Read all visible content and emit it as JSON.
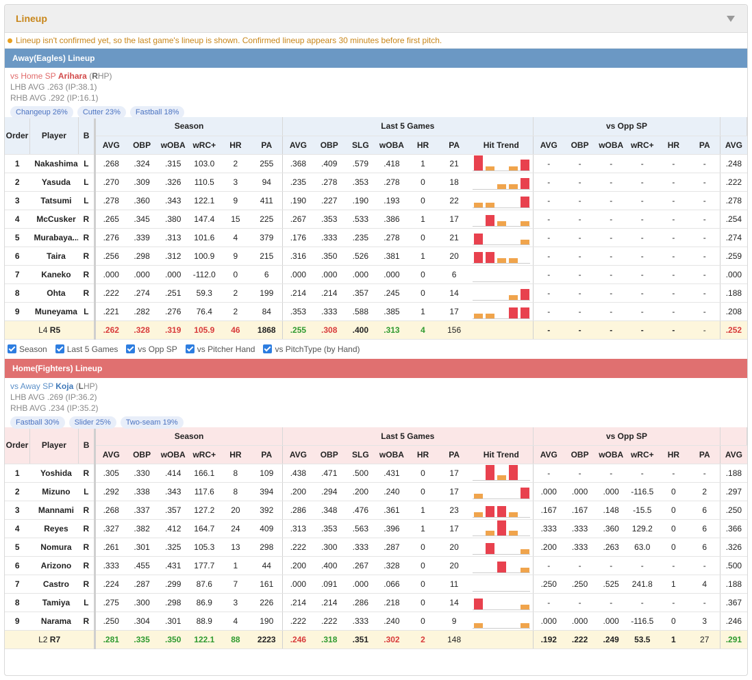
{
  "panel": {
    "title": "Lineup"
  },
  "notice": "Lineup isn't confirmed yet, so the last game's lineup is shown. Confirmed lineup appears 30 minutes before first pitch.",
  "headers": {
    "order": "Order",
    "player": "Player",
    "b": "B",
    "season": "Season",
    "last5": "Last 5 Games",
    "vsopp": "vs Opp SP",
    "avg": "AVG",
    "obp": "OBP",
    "woba": "wOBA",
    "wrc": "wRC+",
    "hr": "HR",
    "pa": "PA",
    "slg": "SLG",
    "hittrend": "Hit Trend"
  },
  "checkboxes": [
    "Season",
    "Last 5 Games",
    "vs Opp SP",
    "vs Pitcher Hand",
    "vs PitchType (by Hand)"
  ],
  "colors": {
    "hit": "#e8414e",
    "out": "#f0a44c",
    "away": "#6b98c4",
    "home": "#e07070"
  },
  "away": {
    "bar": "Away(Eagles) Lineup",
    "sp_prefix": "vs Home SP ",
    "sp_name": "Arihara",
    "sp_hand_open": "(",
    "sp_hand_letter": "R",
    "sp_hand_rest": "HP)",
    "lhb": "LHB AVG .263 (IP:38.1)",
    "rhb": "RHB AVG .292 (IP:16.1)",
    "pitches": [
      "Changeup 26%",
      "Cutter 23%",
      "Fastball 18%"
    ],
    "rows": [
      {
        "o": "1",
        "n": "Nakashima",
        "b": "L",
        "s": [
          ".268",
          ".324",
          ".315",
          "103.0",
          "2",
          "255"
        ],
        "l": [
          ".368",
          ".409",
          ".579",
          ".418",
          "1",
          "21"
        ],
        "t": [
          [
            "hit",
            22
          ],
          [
            "out",
            6
          ],
          [
            "none",
            0
          ],
          [
            "out",
            6
          ],
          [
            "hit",
            16
          ]
        ],
        "v": [
          "-",
          "-",
          "-",
          "-",
          "-",
          "-"
        ],
        "x": ".248"
      },
      {
        "o": "2",
        "n": "Yasuda",
        "b": "L",
        "s": [
          ".270",
          ".309",
          ".326",
          "110.5",
          "3",
          "94"
        ],
        "l": [
          ".235",
          ".278",
          ".353",
          ".278",
          "0",
          "18"
        ],
        "t": [
          [
            "none",
            0
          ],
          [
            "none",
            0
          ],
          [
            "out",
            7
          ],
          [
            "out",
            7
          ],
          [
            "hit",
            16
          ]
        ],
        "v": [
          "-",
          "-",
          "-",
          "-",
          "-",
          "-"
        ],
        "x": ".222"
      },
      {
        "o": "3",
        "n": "Tatsumi",
        "b": "L",
        "s": [
          ".278",
          ".360",
          ".343",
          "122.1",
          "9",
          "411"
        ],
        "l": [
          ".190",
          ".227",
          ".190",
          ".193",
          "0",
          "22"
        ],
        "t": [
          [
            "out",
            7
          ],
          [
            "out",
            7
          ],
          [
            "none",
            0
          ],
          [
            "none",
            0
          ],
          [
            "hit",
            16
          ]
        ],
        "v": [
          "-",
          "-",
          "-",
          "-",
          "-",
          "-"
        ],
        "x": ".278"
      },
      {
        "o": "4",
        "n": "McCusker",
        "b": "R",
        "s": [
          ".265",
          ".345",
          ".380",
          "147.4",
          "15",
          "225"
        ],
        "l": [
          ".267",
          ".353",
          ".533",
          ".386",
          "1",
          "17"
        ],
        "t": [
          [
            "none",
            0
          ],
          [
            "hit",
            16
          ],
          [
            "out",
            7
          ],
          [
            "none",
            0
          ],
          [
            "out",
            7
          ]
        ],
        "v": [
          "-",
          "-",
          "-",
          "-",
          "-",
          "-"
        ],
        "x": ".254"
      },
      {
        "o": "5",
        "n": "Murabaya...",
        "b": "R",
        "s": [
          ".276",
          ".339",
          ".313",
          "101.6",
          "4",
          "379"
        ],
        "l": [
          ".176",
          ".333",
          ".235",
          ".278",
          "0",
          "21"
        ],
        "t": [
          [
            "hit",
            16
          ],
          [
            "none",
            0
          ],
          [
            "none",
            0
          ],
          [
            "none",
            0
          ],
          [
            "out",
            7
          ]
        ],
        "v": [
          "-",
          "-",
          "-",
          "-",
          "-",
          "-"
        ],
        "x": ".274"
      },
      {
        "o": "6",
        "n": "Taira",
        "b": "R",
        "s": [
          ".256",
          ".298",
          ".312",
          "100.9",
          "9",
          "215"
        ],
        "l": [
          ".316",
          ".350",
          ".526",
          ".381",
          "1",
          "20"
        ],
        "t": [
          [
            "hit",
            16
          ],
          [
            "hit",
            16
          ],
          [
            "out",
            7
          ],
          [
            "out",
            7
          ],
          [
            "none",
            0
          ]
        ],
        "v": [
          "-",
          "-",
          "-",
          "-",
          "-",
          "-"
        ],
        "x": ".259"
      },
      {
        "o": "7",
        "n": "Kaneko",
        "b": "R",
        "s": [
          ".000",
          ".000",
          ".000",
          "-112.0",
          "0",
          "6"
        ],
        "l": [
          ".000",
          ".000",
          ".000",
          ".000",
          "0",
          "6"
        ],
        "t": [
          [
            "none",
            0
          ],
          [
            "none",
            0
          ],
          [
            "none",
            0
          ],
          [
            "none",
            0
          ],
          [
            "none",
            0
          ]
        ],
        "v": [
          "-",
          "-",
          "-",
          "-",
          "-",
          "-"
        ],
        "x": ".000"
      },
      {
        "o": "8",
        "n": "Ohta",
        "b": "R",
        "s": [
          ".222",
          ".274",
          ".251",
          "59.3",
          "2",
          "199"
        ],
        "l": [
          ".214",
          ".214",
          ".357",
          ".245",
          "0",
          "14"
        ],
        "t": [
          [
            "none",
            0
          ],
          [
            "none",
            0
          ],
          [
            "none",
            0
          ],
          [
            "out",
            7
          ],
          [
            "hit",
            16
          ]
        ],
        "v": [
          "-",
          "-",
          "-",
          "-",
          "-",
          "-"
        ],
        "x": ".188"
      },
      {
        "o": "9",
        "n": "Muneyama",
        "b": "L",
        "s": [
          ".221",
          ".282",
          ".276",
          "76.4",
          "2",
          "84"
        ],
        "l": [
          ".353",
          ".333",
          ".588",
          ".385",
          "1",
          "17"
        ],
        "t": [
          [
            "out",
            7
          ],
          [
            "out",
            7
          ],
          [
            "none",
            0
          ],
          [
            "hit",
            16
          ],
          [
            "hit",
            16
          ]
        ],
        "v": [
          "-",
          "-",
          "-",
          "-",
          "-",
          "-"
        ],
        "x": ".208"
      }
    ],
    "total": {
      "lead": "L4 ",
      "leadb": "R5",
      "s": [
        ".262",
        ".328",
        ".319",
        "105.9",
        "46",
        "1868"
      ],
      "l": [
        ".255",
        ".308",
        ".400",
        ".313",
        "4",
        "156"
      ],
      "v": [
        "-",
        "-",
        "-",
        "-",
        "-",
        "-"
      ],
      "x": ".252"
    }
  },
  "home": {
    "bar": "Home(Fighters) Lineup",
    "sp_prefix": "vs Away SP ",
    "sp_name": "Koja",
    "sp_hand_open": "(",
    "sp_hand_letter": "L",
    "sp_hand_rest": "HP)",
    "lhb": "LHB AVG .269 (IP:36.2)",
    "rhb": "RHB AVG .234 (IP:35.2)",
    "pitches": [
      "Fastball 30%",
      "Slider 25%",
      "Two-seam 19%"
    ],
    "rows": [
      {
        "o": "1",
        "n": "Yoshida",
        "b": "R",
        "s": [
          ".305",
          ".330",
          ".414",
          "166.1",
          "8",
          "109"
        ],
        "l": [
          ".438",
          ".471",
          ".500",
          ".431",
          "0",
          "17"
        ],
        "t": [
          [
            "none",
            0
          ],
          [
            "hit",
            22
          ],
          [
            "out",
            7
          ],
          [
            "hit",
            22
          ],
          [
            "none",
            0
          ]
        ],
        "v": [
          "-",
          "-",
          "-",
          "-",
          "-",
          "-"
        ],
        "x": ".188"
      },
      {
        "o": "2",
        "n": "Mizuno",
        "b": "L",
        "s": [
          ".292",
          ".338",
          ".343",
          "117.6",
          "8",
          "394"
        ],
        "l": [
          ".200",
          ".294",
          ".200",
          ".240",
          "0",
          "17"
        ],
        "t": [
          [
            "out",
            7
          ],
          [
            "none",
            0
          ],
          [
            "none",
            0
          ],
          [
            "none",
            0
          ],
          [
            "hit",
            16
          ]
        ],
        "v": [
          ".000",
          ".000",
          ".000",
          "-116.5",
          "0",
          "2"
        ],
        "x": ".297"
      },
      {
        "o": "3",
        "n": "Mannami",
        "b": "R",
        "s": [
          ".268",
          ".337",
          ".357",
          "127.2",
          "20",
          "392"
        ],
        "l": [
          ".286",
          ".348",
          ".476",
          ".361",
          "1",
          "23"
        ],
        "t": [
          [
            "out",
            7
          ],
          [
            "hit",
            16
          ],
          [
            "hit",
            16
          ],
          [
            "out",
            7
          ],
          [
            "none",
            0
          ]
        ],
        "v": [
          ".167",
          ".167",
          ".148",
          "-15.5",
          "0",
          "6"
        ],
        "x": ".250"
      },
      {
        "o": "4",
        "n": "Reyes",
        "b": "R",
        "s": [
          ".327",
          ".382",
          ".412",
          "164.7",
          "24",
          "409"
        ],
        "l": [
          ".313",
          ".353",
          ".563",
          ".396",
          "1",
          "17"
        ],
        "t": [
          [
            "none",
            0
          ],
          [
            "out",
            7
          ],
          [
            "hit",
            22
          ],
          [
            "out",
            7
          ],
          [
            "none",
            0
          ]
        ],
        "v": [
          ".333",
          ".333",
          ".360",
          "129.2",
          "0",
          "6"
        ],
        "x": ".366"
      },
      {
        "o": "5",
        "n": "Nomura",
        "b": "R",
        "s": [
          ".261",
          ".301",
          ".325",
          "105.3",
          "13",
          "298"
        ],
        "l": [
          ".222",
          ".300",
          ".333",
          ".287",
          "0",
          "20"
        ],
        "t": [
          [
            "none",
            0
          ],
          [
            "hit",
            16
          ],
          [
            "none",
            0
          ],
          [
            "none",
            0
          ],
          [
            "out",
            7
          ]
        ],
        "v": [
          ".200",
          ".333",
          ".263",
          "63.0",
          "0",
          "6"
        ],
        "x": ".326"
      },
      {
        "o": "6",
        "n": "Arizono",
        "b": "R",
        "s": [
          ".333",
          ".455",
          ".431",
          "177.7",
          "1",
          "44"
        ],
        "l": [
          ".200",
          ".400",
          ".267",
          ".328",
          "0",
          "20"
        ],
        "t": [
          [
            "none",
            0
          ],
          [
            "none",
            0
          ],
          [
            "hit",
            16
          ],
          [
            "none",
            0
          ],
          [
            "out",
            7
          ]
        ],
        "v": [
          "-",
          "-",
          "-",
          "-",
          "-",
          "-"
        ],
        "x": ".500"
      },
      {
        "o": "7",
        "n": "Castro",
        "b": "R",
        "s": [
          ".224",
          ".287",
          ".299",
          "87.6",
          "7",
          "161"
        ],
        "l": [
          ".000",
          ".091",
          ".000",
          ".066",
          "0",
          "11"
        ],
        "t": [
          [
            "none",
            0
          ],
          [
            "none",
            0
          ],
          [
            "none",
            0
          ],
          [
            "none",
            0
          ],
          [
            "none",
            0
          ]
        ],
        "v": [
          ".250",
          ".250",
          ".525",
          "241.8",
          "1",
          "4"
        ],
        "x": ".188"
      },
      {
        "o": "8",
        "n": "Tamiya",
        "b": "L",
        "s": [
          ".275",
          ".300",
          ".298",
          "86.9",
          "3",
          "226"
        ],
        "l": [
          ".214",
          ".214",
          ".286",
          ".218",
          "0",
          "14"
        ],
        "t": [
          [
            "hit",
            16
          ],
          [
            "none",
            0
          ],
          [
            "none",
            0
          ],
          [
            "none",
            0
          ],
          [
            "out",
            7
          ]
        ],
        "v": [
          "-",
          "-",
          "-",
          "-",
          "-",
          "-"
        ],
        "x": ".367"
      },
      {
        "o": "9",
        "n": "Narama",
        "b": "R",
        "s": [
          ".250",
          ".304",
          ".301",
          "88.9",
          "4",
          "190"
        ],
        "l": [
          ".222",
          ".222",
          ".333",
          ".240",
          "0",
          "9"
        ],
        "t": [
          [
            "out",
            7
          ],
          [
            "none",
            0
          ],
          [
            "none",
            0
          ],
          [
            "none",
            0
          ],
          [
            "out",
            7
          ]
        ],
        "v": [
          ".000",
          ".000",
          ".000",
          "-116.5",
          "0",
          "3"
        ],
        "x": ".246"
      }
    ],
    "total": {
      "lead": "L2 ",
      "leadb": "R7",
      "s": [
        ".281",
        ".335",
        ".350",
        "122.1",
        "88",
        "2223"
      ],
      "l": [
        ".246",
        ".318",
        ".351",
        ".302",
        "2",
        "148"
      ],
      "v": [
        ".192",
        ".222",
        ".249",
        "53.5",
        "1",
        "27"
      ],
      "x": ".291"
    }
  },
  "total_colors": {
    "away": {
      "s": [
        "red",
        "red",
        "red",
        "red",
        "red",
        ""
      ],
      "l": [
        "green",
        "red",
        "",
        "green",
        "green",
        ""
      ],
      "v": [
        "",
        "",
        "",
        "",
        "",
        ""
      ],
      "x": "red"
    },
    "home": {
      "s": [
        "green",
        "green",
        "green",
        "green",
        "green",
        ""
      ],
      "l": [
        "red",
        "green",
        "",
        "red",
        "red",
        ""
      ],
      "v": [
        "",
        "",
        "",
        "",
        "",
        ""
      ],
      "x": "green"
    }
  }
}
